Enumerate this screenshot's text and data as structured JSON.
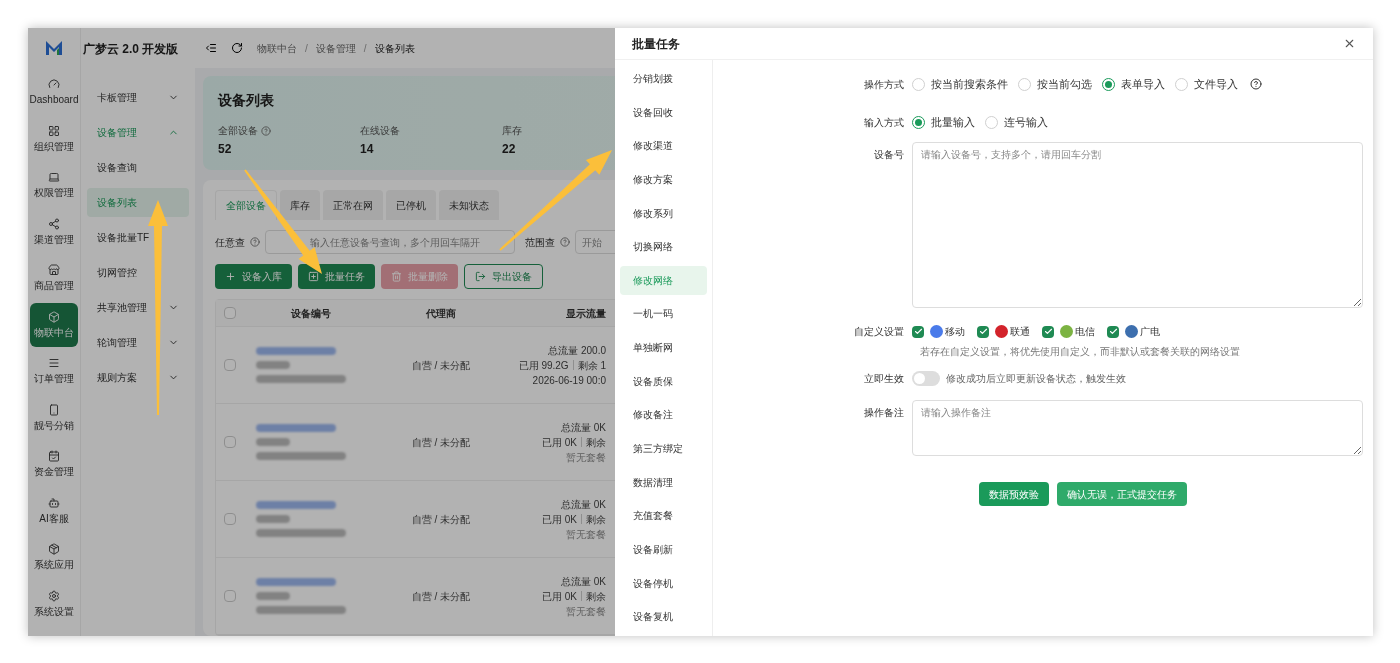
{
  "logo_text": "广梦云 2.0 开发版",
  "rail": [
    {
      "label": "Dashboard",
      "selected": false
    },
    {
      "label": "组织管理",
      "selected": false
    },
    {
      "label": "权限管理",
      "selected": false
    },
    {
      "label": "渠道管理",
      "selected": false
    },
    {
      "label": "商品管理",
      "selected": false
    },
    {
      "label": "物联中台",
      "selected": true
    },
    {
      "label": "订单管理",
      "selected": false
    },
    {
      "label": "靓号分销",
      "selected": false
    },
    {
      "label": "资金管理",
      "selected": false
    },
    {
      "label": "AI客服",
      "selected": false
    },
    {
      "label": "系统应用",
      "selected": false
    },
    {
      "label": "系统设置",
      "selected": false
    }
  ],
  "submenu": [
    {
      "label": "卡板管理",
      "expanded": false
    },
    {
      "label": "设备管理",
      "expanded": true,
      "children": [
        {
          "label": "设备查询",
          "selected": false
        },
        {
          "label": "设备列表",
          "selected": true
        },
        {
          "label": "设备批量TF",
          "selected": false
        },
        {
          "label": "切网管控",
          "selected": false
        }
      ]
    },
    {
      "label": "共享池管理",
      "expanded": false
    },
    {
      "label": "轮询管理",
      "expanded": false
    },
    {
      "label": "规则方案",
      "expanded": false
    }
  ],
  "breadcrumb": {
    "separator": "/",
    "items": [
      "物联中台",
      "设备管理",
      "设备列表"
    ]
  },
  "summary": {
    "title": "设备列表",
    "stats": [
      {
        "label": "全部设备",
        "value": "52",
        "help": true
      },
      {
        "label": "在线设备",
        "value": "14",
        "help": false
      },
      {
        "label": "库存",
        "value": "22",
        "help": false
      }
    ]
  },
  "tabs": [
    {
      "label": "全部设备",
      "selected": true
    },
    {
      "label": "库存",
      "selected": false
    },
    {
      "label": "正常在网",
      "selected": false
    },
    {
      "label": "已停机",
      "selected": false
    },
    {
      "label": "未知状态",
      "selected": false
    }
  ],
  "filters": [
    {
      "label": "任意查",
      "placeholder": "输入任意设备号查询，多个用回车隔开"
    },
    {
      "label": "范围查",
      "placeholder": "开始"
    }
  ],
  "actions": [
    {
      "label": "设备入库",
      "kind": "primary"
    },
    {
      "label": "批量任务",
      "kind": "primary"
    },
    {
      "label": "批量删除",
      "kind": "danger"
    },
    {
      "label": "导出设备",
      "kind": "outline"
    }
  ],
  "table": {
    "columns": [
      "设备编号",
      "代理商",
      "显示流量"
    ],
    "all_checked": false,
    "rows": [
      {
        "checked": false,
        "agent": "自营 / 未分配",
        "traffic": [
          "总流量 200.0",
          "已用 99.2G",
          "剩余 1",
          "2026-06-19 00:0"
        ]
      },
      {
        "checked": false,
        "agent": "自营 / 未分配",
        "traffic": [
          "总流量 0K",
          "已用 0K",
          "剩余",
          "暂无套餐"
        ]
      },
      {
        "checked": false,
        "agent": "自营 / 未分配",
        "traffic": [
          "总流量 0K",
          "已用 0K",
          "剩余",
          "暂无套餐"
        ]
      },
      {
        "checked": false,
        "agent": "自营 / 未分配",
        "traffic": [
          "总流量 0K",
          "已用 0K",
          "剩余",
          "暂无套餐"
        ]
      }
    ]
  },
  "drawer": {
    "title": "批量任务",
    "menu": [
      {
        "label": "分销划拨",
        "selected": false
      },
      {
        "label": "设备回收",
        "selected": false
      },
      {
        "label": "修改渠道",
        "selected": false
      },
      {
        "label": "修改方案",
        "selected": false
      },
      {
        "label": "修改系列",
        "selected": false
      },
      {
        "label": "切换网络",
        "selected": false
      },
      {
        "label": "修改网络",
        "selected": true
      },
      {
        "label": "一机一码",
        "selected": false
      },
      {
        "label": "单独断网",
        "selected": false
      },
      {
        "label": "设备质保",
        "selected": false
      },
      {
        "label": "修改备注",
        "selected": false
      },
      {
        "label": "第三方绑定",
        "selected": false
      },
      {
        "label": "数据清理",
        "selected": false
      },
      {
        "label": "充值套餐",
        "selected": false
      },
      {
        "label": "设备刷新",
        "selected": false
      },
      {
        "label": "设备停机",
        "selected": false
      },
      {
        "label": "设备复机",
        "selected": false
      }
    ],
    "op_mode": {
      "label": "操作方式",
      "options": [
        {
          "label": "按当前搜索条件",
          "selected": false
        },
        {
          "label": "按当前勾选",
          "selected": false
        },
        {
          "label": "表单导入",
          "selected": true
        },
        {
          "label": "文件导入",
          "selected": false
        }
      ]
    },
    "input_mode": {
      "label": "输入方式",
      "options": [
        {
          "label": "批量输入",
          "selected": true
        },
        {
          "label": "连号输入",
          "selected": false
        }
      ]
    },
    "device_no": {
      "label": "设备号",
      "placeholder": "请输入设备号，支持多个，请用回车分割"
    },
    "custom": {
      "label": "自定义设置",
      "carriers": [
        {
          "label": "移动",
          "checked": true,
          "color": "#4a7bea"
        },
        {
          "label": "联通",
          "checked": true,
          "color": "#d3232b"
        },
        {
          "label": "电信",
          "checked": true,
          "color": "#7cb342"
        },
        {
          "label": "广电",
          "checked": true,
          "color": "#3d6fae"
        }
      ],
      "hint": "若存在自定义设置，将优先使用自定义，而非默认或套餐关联的网络设置"
    },
    "immediate": {
      "label": "立即生效",
      "on": false,
      "hint": "修改成功后立即更新设备状态，触发生效"
    },
    "remark": {
      "label": "操作备注",
      "placeholder": "请输入操作备注"
    },
    "buttons": [
      "数据预效验",
      "确认无误，正式提交任务"
    ]
  }
}
